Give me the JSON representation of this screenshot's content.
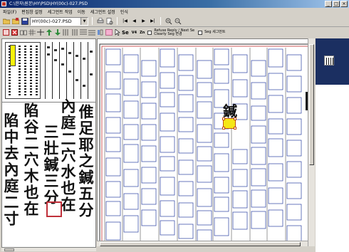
{
  "window": {
    "title": "C:\\한자\\원본\\HY\\PSD\\HY(00c)-027.PSD",
    "buttons": [
      "_",
      "□",
      "×"
    ]
  },
  "menu": {
    "items": [
      "파일(F)",
      "편집창 설정",
      "세그먼트 작업",
      "이동",
      "세그먼트 설정",
      "인식"
    ]
  },
  "toolbar": {
    "file_name": "HY(00c)-027.PSD",
    "dropdown_arrow": "▼",
    "nav_first": "|◀",
    "nav_prev": "◀",
    "nav_next": "▶",
    "nav_last": "▶|",
    "se_label": "Se",
    "v4_label": "V4",
    "zn_label": "Zn",
    "option1": "Refuse Reply / Next Se",
    "option2": "Clearly Seg 변경",
    "option3": "Seg 세그먼트"
  },
  "calligraphy": {
    "columns": [
      {
        "text": "倠足耶之鍼五分"
      },
      {
        "text": "內庭二穴水也在"
      },
      {
        "text": "三壯鍼三分"
      },
      {
        "text": "陷谷二穴木也在"
      },
      {
        "text": "陷中去內庭二寸"
      }
    ]
  },
  "canvas": {
    "recognized_char": "鍼"
  },
  "colors": {
    "title_gradient_start": "#0a246a",
    "selection_fill": "#f5e716",
    "highlight_box": "#c0303a",
    "panel_dark": "#1b2f61"
  }
}
